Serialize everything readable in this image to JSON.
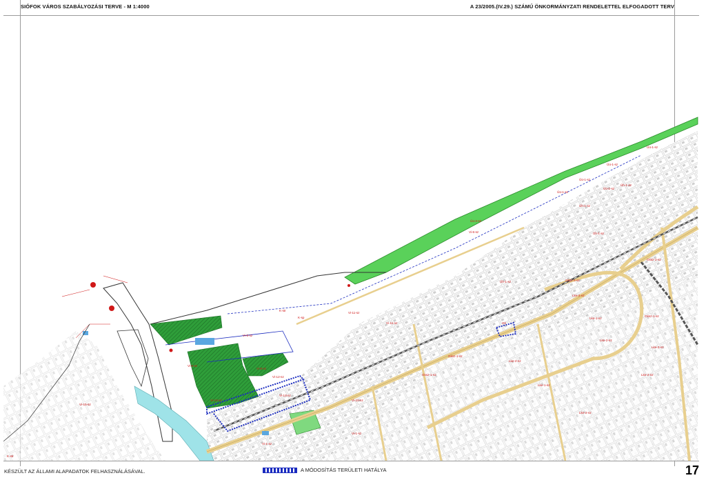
{
  "header": {
    "title_left": "SIÓFOK VÁROS SZABÁLYOZÁSI TERVE  -  M 1:4000",
    "title_right": "A 23/2005.(IV.29.) SZÁMÚ ÖNKORMÁNYZATI RENDELETTEL ELFOGADOTT TERV"
  },
  "footer": {
    "source_note": "KÉSZÜLT AZ ÁLLAMI ALAPADATOK FELHASZNÁLÁSÁVAL.",
    "legend_label": "A MÓDOSÍTÁS TERÜLETI HATÁLYA",
    "page_number": "17"
  },
  "map": {
    "colors": {
      "lake_shore_green": "#5ad15a",
      "park_green": "#2f9e3a",
      "road_fill": "#e8cf8e",
      "railway": "#555555",
      "zone_label": "#d01818",
      "amendment_boundary": "#1a2bbf",
      "water": "#9fe3e8"
    },
    "zone_labels": [
      "Üü-1-sz",
      "Üü-1-sz",
      "Üü-1-sz",
      "Üü-1-sz",
      "Üü-1-sz",
      "Üh-1-sz",
      "Üh-1-sz",
      "Üh-1-sz",
      "Üh-1-sz",
      "Vi-6-sz",
      "Vi-6-sz",
      "Vi-8-sz",
      "Vi-8-sz",
      "Vi-11-sz",
      "Vi-11-sz",
      "Vi-12-sz",
      "Vi-13-sz",
      "Vi-13-sz",
      "Vi-15-sz",
      "Vi-10-sz",
      "Vi-1-sz",
      "Vi-1-sz",
      "Gksz-1-sz",
      "Gksz-1-sz",
      "Gksz-1-sz",
      "Gksz-2-sz",
      "Gksz-2-sz",
      "Lke-2-sz",
      "Lke-2-sz",
      "Lke-2-sz",
      "Lke-2-sz",
      "Lke-2-sz",
      "Lke-1-sz",
      "Lke-1-sz",
      "Lke-3-sz",
      "K-str",
      "K-str",
      "K-sp",
      "Üü-3-sz",
      "Gk"
    ]
  }
}
